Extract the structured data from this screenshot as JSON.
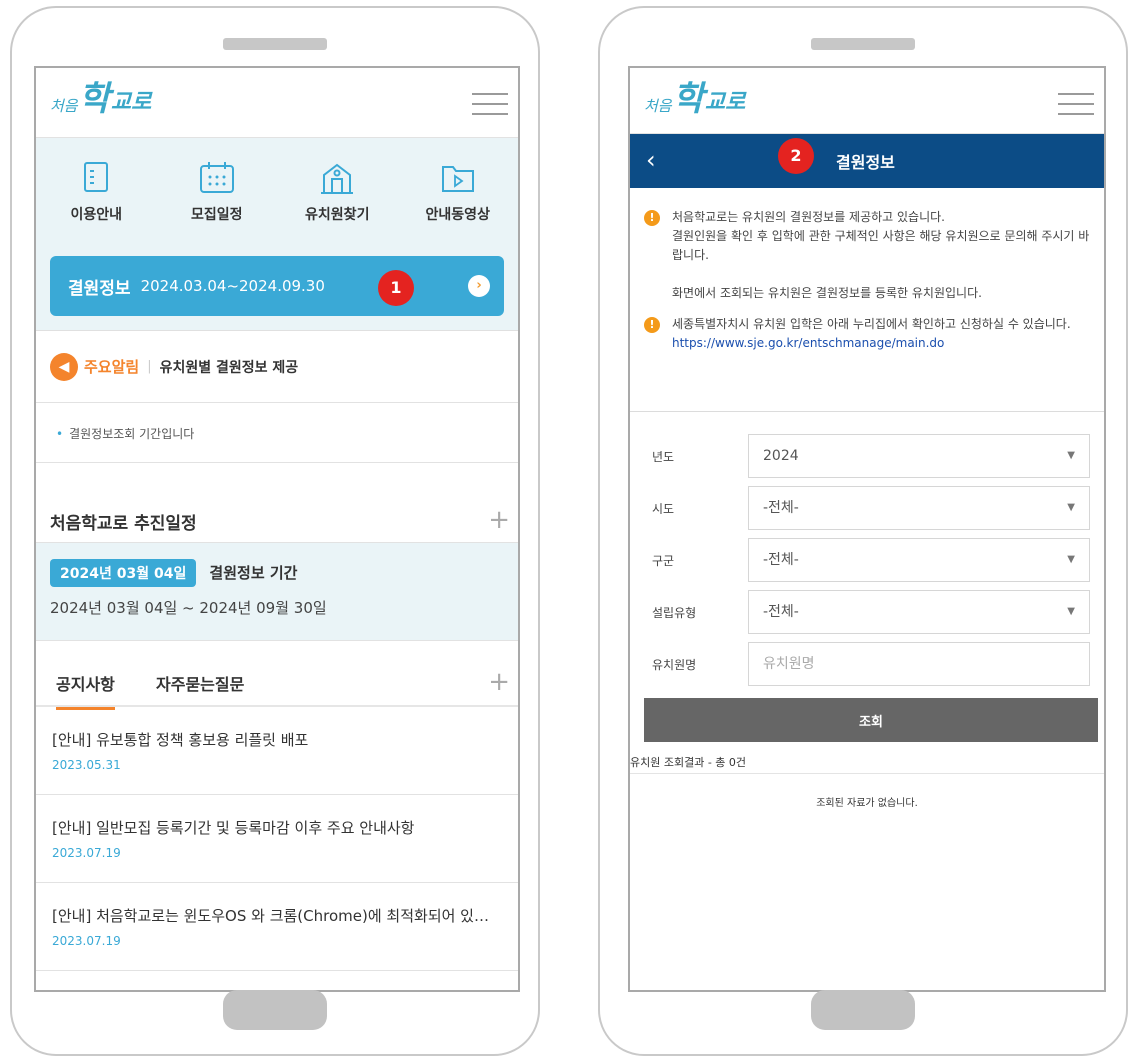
{
  "left": {
    "logo": {
      "part1": "처음",
      "part2": "학",
      "part3": "교로"
    },
    "quick_menu": [
      {
        "label": "이용안내",
        "icon": "document-icon"
      },
      {
        "label": "모집일정",
        "icon": "calendar-icon"
      },
      {
        "label": "유치원찾기",
        "icon": "building-icon"
      },
      {
        "label": "안내동영상",
        "icon": "video-folder-icon"
      }
    ],
    "banner": {
      "title": "결원정보",
      "date_range": "2024.03.04~2024.09.30"
    },
    "notice": {
      "tag": "주요알림",
      "text": "유치원별 결원정보 제공"
    },
    "notice_line": "결원정보조회 기간입니다",
    "schedule": {
      "title": "처음학교로 추진일정",
      "date_pill": "2024년 03월 04일",
      "name": "결원정보 기간",
      "range": "2024년 03월 04일 ~ 2024년 09월 30일"
    },
    "tabs": [
      "공지사항",
      "자주묻는질문"
    ],
    "news": [
      {
        "title": "[안내] 유보통합 정책 홍보용 리플릿 배포",
        "date": "2023.05.31"
      },
      {
        "title": "[안내] 일반모집 등록기간 및 등록마감 이후 주요 안내사항",
        "date": "2023.07.19"
      },
      {
        "title": "[안내] 처음학교로는 윈도우OS 와 크롬(Chrome)에 최적화되어 있습니다",
        "date": "2023.07.19"
      }
    ],
    "badge": "1"
  },
  "right": {
    "logo": {
      "part1": "처음",
      "part2": "학",
      "part3": "교로"
    },
    "header_title": "결원정보",
    "badge": "2",
    "info": {
      "line1": "처음학교로는 유치원의 결원정보를 제공하고 있습니다.",
      "line2": "결원인원을 확인 후 입학에 관한 구체적인 사항은 해당 유치원으로 문의해 주시기 바랍니다.",
      "line3": "화면에서 조회되는 유치원은 결원정보를 등록한 유치원입니다.",
      "line4": "세종특별자치시 유치원 입학은 아래 누리집에서 확인하고 신청하실 수 있습니다.",
      "link": "https://www.sje.go.kr/entschmanage/main.do"
    },
    "form": {
      "year_label": "년도",
      "year_value": "2024",
      "sido_label": "시도",
      "sido_value": "-전체-",
      "gugun_label": "구군",
      "gugun_value": "-전체-",
      "type_label": "설립유형",
      "type_value": "-전체-",
      "name_label": "유치원명",
      "name_placeholder": "유치원명",
      "search_label": "조회"
    },
    "result_count": "유치원 조회결과 - 총 0건",
    "result_empty": "조회된 자료가 없습니다."
  }
}
